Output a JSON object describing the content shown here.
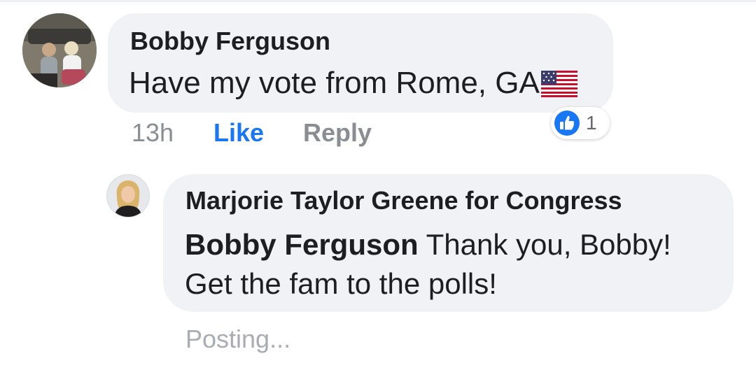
{
  "comment": {
    "author": "Bobby Ferguson",
    "text": "Have my vote from Rome, GA",
    "flag_emoji_icon": "us-flag-icon",
    "time": "13h",
    "like_label": "Like",
    "reply_label": "Reply",
    "reaction": {
      "icon": "like-thumb-icon",
      "count": "1"
    }
  },
  "reply": {
    "author": "Marjorie Taylor Greene for Congress",
    "mention": "Bobby Ferguson",
    "text_line1": " Thank you, Bobby!",
    "text_line2": "Get the fam to the polls!",
    "status": "Posting..."
  },
  "colors": {
    "bubble": "#f0f2f5",
    "like_blue": "#1877f2",
    "meta_gray": "#8a8d91",
    "text": "#1c1e21"
  }
}
